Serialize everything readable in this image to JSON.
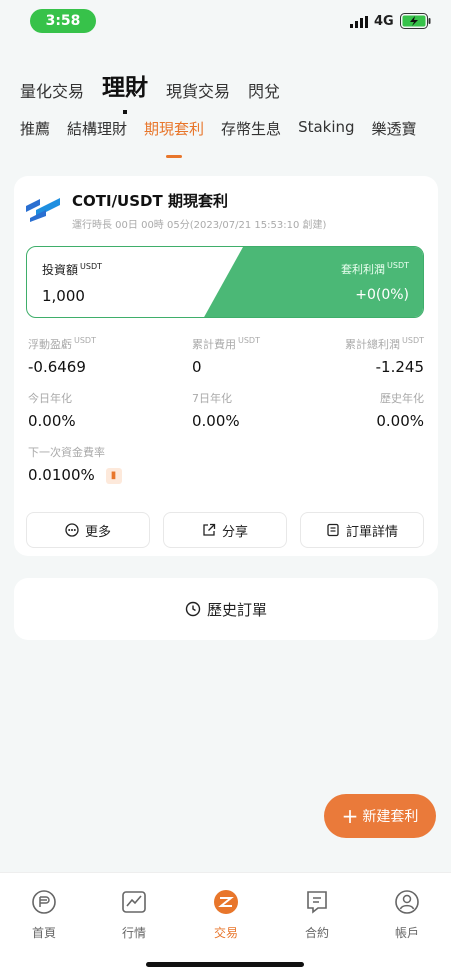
{
  "status_bar": {
    "time": "3:58",
    "network": "4G"
  },
  "top_nav": [
    "量化交易",
    "理財",
    "現貨交易",
    "閃兌"
  ],
  "top_nav_active": 1,
  "sub_tabs": [
    "推薦",
    "結構理財",
    "期現套利",
    "存幣生息",
    "Staking",
    "樂透寶"
  ],
  "sub_tabs_active": 2,
  "card": {
    "pair": "COTI/USDT 期現套利",
    "subtitle": "運行時長 00日 00時 05分(2023/07/21 15:53:10 創建)",
    "invest_label": "投資額",
    "invest_unit": "USDT",
    "invest_value": "1,000",
    "profit_label": "套利利潤",
    "profit_unit": "USDT",
    "profit_value": "+0(0%)",
    "stats": [
      {
        "label": "浮動盈虧",
        "unit": "USDT",
        "value": "-0.6469"
      },
      {
        "label": "累計費用",
        "unit": "USDT",
        "value": "0"
      },
      {
        "label": "累計總利潤",
        "unit": "USDT",
        "value": "-1.245"
      },
      {
        "label": "今日年化",
        "unit": "",
        "value": "0.00%"
      },
      {
        "label": "7日年化",
        "unit": "",
        "value": "0.00%"
      },
      {
        "label": "歷史年化",
        "unit": "",
        "value": "0.00%"
      },
      {
        "label": "下一次資金費率",
        "unit": "",
        "value": "0.0100%"
      }
    ],
    "actions": {
      "more": "更多",
      "share": "分享",
      "order_detail": "訂單詳情"
    }
  },
  "history": "歷史訂單",
  "new_button": "新建套利",
  "bottom_nav": [
    "首頁",
    "行情",
    "交易",
    "合約",
    "帳戶"
  ],
  "bottom_nav_active": 2,
  "colors": {
    "accent": "#e8762b",
    "green": "#4bb876",
    "status_pill": "#37c24a"
  }
}
